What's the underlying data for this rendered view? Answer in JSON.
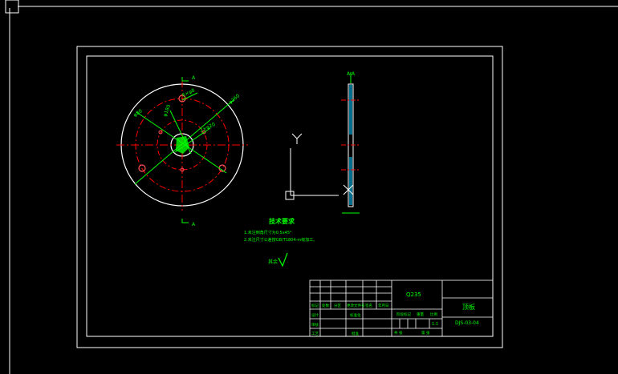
{
  "app": {
    "background": "#000000"
  },
  "colors": {
    "border": "#ffffff",
    "geometry": "#ffffff",
    "centerline": "#ff0000",
    "dimension": "#00ff00",
    "hatch": "#00c8ff",
    "ucs": "#ffffff"
  },
  "section_marks": {
    "top": "A",
    "bottom": "A",
    "side_view": "A-A"
  },
  "dimensions": [
    "6×φ8",
    "φ260",
    "φ80",
    "2×φ20",
    "φ180"
  ],
  "tech_requirements": {
    "title": "技术要求",
    "items": [
      "1.未注倒角尺寸为0.5x45°",
      "2.未注尺寸公差按GB/T1804-m级加工。"
    ]
  },
  "roughness_note": "其余",
  "title_block": {
    "part_name": "顶板",
    "drawing_no": "DJS-03-04",
    "material": "Q235",
    "scale": "1:1",
    "row_labels": [
      "标记",
      "处数",
      "分区",
      "更改文件号",
      "签名",
      "年月日"
    ],
    "design": "设计",
    "check": "审核",
    "process": "工艺",
    "standardization": "标准化",
    "approve": "批准",
    "stage_marks": "阶段标记",
    "weight": "重量",
    "ratio": "比例",
    "sheet_total": "共 张",
    "sheet_no": "第 张"
  }
}
